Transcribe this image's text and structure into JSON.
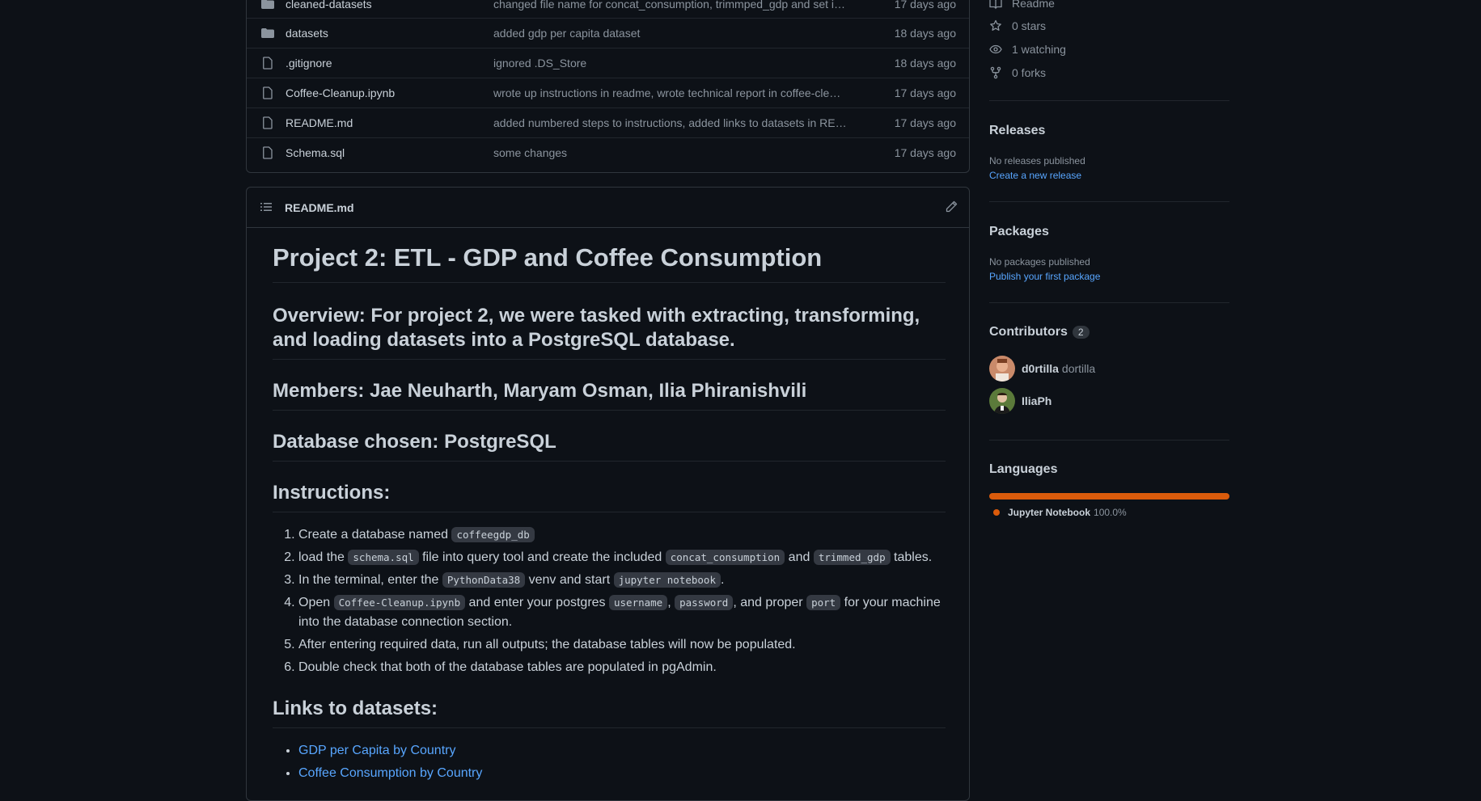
{
  "files": [
    {
      "type": "folder",
      "name": "cleaned-datasets",
      "message": "changed file name for concat_consumption, trimmped_gdp and set indi…",
      "age": "17 days ago"
    },
    {
      "type": "folder",
      "name": "datasets",
      "message": "added gdp per capita dataset",
      "age": "18 days ago"
    },
    {
      "type": "file",
      "name": ".gitignore",
      "message": "ignored .DS_Store",
      "age": "18 days ago"
    },
    {
      "type": "file",
      "name": "Coffee-Cleanup.ipynb",
      "message": "wrote up instructions in readme, wrote technical report in coffee-cle…",
      "age": "17 days ago"
    },
    {
      "type": "file",
      "name": "README.md",
      "message": "added numbered steps to instructions, added links to datasets in READ…",
      "age": "17 days ago"
    },
    {
      "type": "file",
      "name": "Schema.sql",
      "message": "some changes",
      "age": "17 days ago"
    }
  ],
  "readme": {
    "filename": "README.md",
    "h1": "Project 2: ETL - GDP and Coffee Consumption",
    "overview": "Overview: For project 2, we were tasked with extracting, transforming, and loading datasets into a PostgreSQL database.",
    "members": "Members: Jae Neuharth, Maryam Osman, Ilia Phiranishvili",
    "database": "Database chosen: PostgreSQL",
    "instructions_heading": "Instructions:",
    "steps": {
      "s1a": "Create a database named ",
      "s1c1": "coffeegdp_db",
      "s2a": "load the ",
      "s2c1": "schema.sql",
      "s2b": " file into query tool and create the included ",
      "s2c2": "concat_consumption",
      "s2d": " and ",
      "s2c3": "trimmed_gdp",
      "s2e": " tables.",
      "s3a": "In the terminal, enter the ",
      "s3c1": "PythonData38",
      "s3b": " venv and start ",
      "s3c2": "jupyter notebook",
      "s3e": ".",
      "s4a": "Open ",
      "s4c1": "Coffee-Cleanup.ipynb",
      "s4b": " and enter your postgres ",
      "s4c2": "username",
      "s4sep": ", ",
      "s4c3": "password",
      "s4d": ", and proper ",
      "s4c4": "port",
      "s4e": " for your machine into the database connection section.",
      "s5": "After entering required data, run all outputs; the database tables will now be populated.",
      "s6": "Double check that both of the database tables are populated in pgAdmin."
    },
    "links_heading": "Links to datasets:",
    "links": [
      "GDP per Capita by Country",
      "Coffee Consumption by Country"
    ]
  },
  "sidebar": {
    "readme": "Readme",
    "stars": "0 stars",
    "watching": "1 watching",
    "forks": "0 forks",
    "releases_title": "Releases",
    "releases_none": "No releases published",
    "releases_link": "Create a new release",
    "packages_title": "Packages",
    "packages_none": "No packages published",
    "packages_link": "Publish your first package",
    "contributors_title": "Contributors",
    "contributors_count": "2",
    "contributors": [
      {
        "login": "d0rtilla",
        "name": "dortilla"
      },
      {
        "login": "IliaPh",
        "name": ""
      }
    ],
    "languages_title": "Languages",
    "language": {
      "name": "Jupyter Notebook",
      "percent": "100.0%",
      "color": "#da5b0b"
    }
  }
}
